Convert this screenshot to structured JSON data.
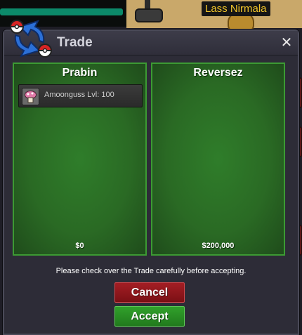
{
  "world": {
    "npc_label": "Lass Nirmala"
  },
  "window": {
    "title": "Trade",
    "close_glyph": "✕"
  },
  "trade": {
    "left": {
      "name": "Prabin",
      "money": "$0",
      "items": [
        {
          "pokemon": "Amoonguss",
          "level_text": "Lvl: 100"
        }
      ]
    },
    "right": {
      "name": "Reversez",
      "money": "$200,000",
      "items": []
    }
  },
  "notice": "Please check over the Trade carefully before accepting.",
  "buttons": {
    "cancel": "Cancel",
    "accept": "Accept"
  },
  "colors": {
    "panel_green": "#2a6a24",
    "cancel_red": "#a41e24",
    "accept_green": "#31a12b",
    "npc_label_text": "#f0c42a"
  },
  "icons": {
    "window_icon": "trade-arrows-pokeball-icon",
    "close": "close-icon",
    "pokemon_sprite": "amoonguss-sprite-icon"
  }
}
